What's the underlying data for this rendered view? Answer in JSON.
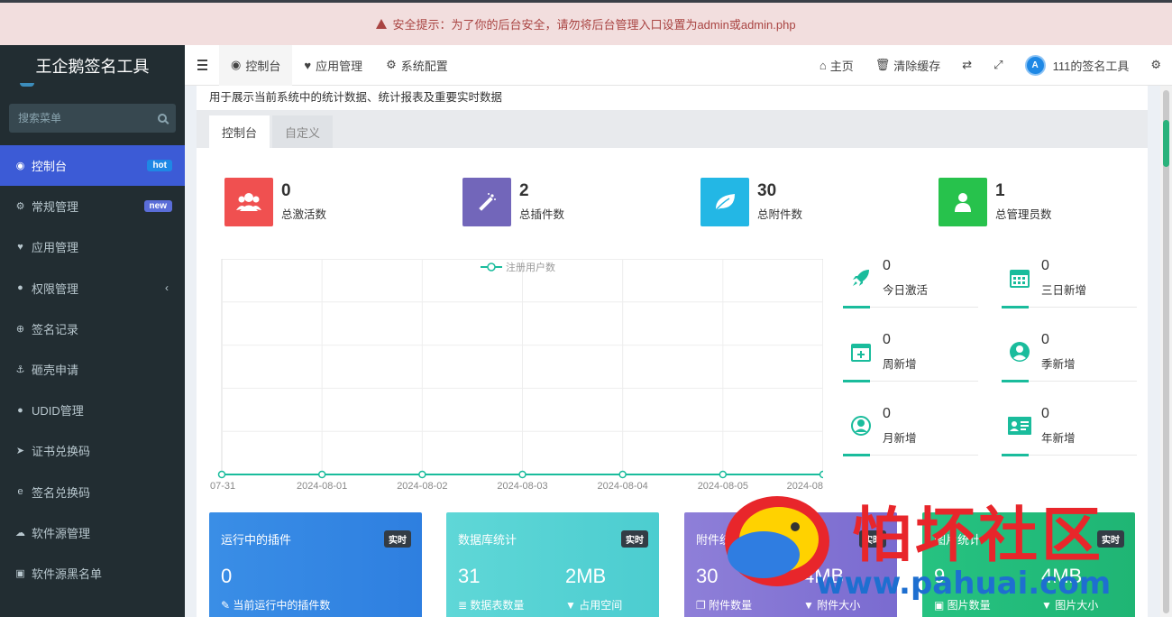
{
  "alert": {
    "text": "安全提示：为了你的后台安全，请勿将后台管理入口设置为admin或admin.php"
  },
  "sidebar": {
    "brand": "王企鹅签名工具",
    "search_placeholder": "搜索菜单",
    "items": [
      {
        "label": "控制台",
        "icon": "dashboard-icon",
        "badge": "hot"
      },
      {
        "label": "常规管理",
        "icon": "cogs-icon",
        "badge": "new"
      },
      {
        "label": "应用管理",
        "icon": "heart-icon"
      },
      {
        "label": "权限管理",
        "icon": "users-icon"
      },
      {
        "label": "签名记录",
        "icon": "download-icon"
      },
      {
        "label": "砸壳申请",
        "icon": "anchor-icon"
      },
      {
        "label": "UDID管理",
        "icon": "apple-icon"
      },
      {
        "label": "证书兑换码",
        "icon": "paper-plane-icon"
      },
      {
        "label": "签名兑换码",
        "icon": "edge-icon"
      },
      {
        "label": "软件源管理",
        "icon": "cloud-icon"
      },
      {
        "label": "软件源黑名单",
        "icon": "box-icon"
      }
    ]
  },
  "topnav": {
    "tabs": [
      "控制台",
      "应用管理",
      "系统配置"
    ],
    "home": "主页",
    "clear_cache": "清除缓存",
    "user": "111的签名工具"
  },
  "page": {
    "description": "用于展示当前系统中的统计数据、统计报表及重要实时数据",
    "tabs": [
      "控制台",
      "自定义"
    ]
  },
  "stats": [
    {
      "value": "0",
      "label": "总激活数",
      "color": "#f05050",
      "icon": "users-icon"
    },
    {
      "value": "2",
      "label": "总插件数",
      "color": "#7266ba",
      "icon": "magic-icon"
    },
    {
      "value": "30",
      "label": "总附件数",
      "color": "#23b7e5",
      "icon": "leaf-icon"
    },
    {
      "value": "1",
      "label": "总管理员数",
      "color": "#27c24c",
      "icon": "user-icon"
    }
  ],
  "mini_stats": [
    {
      "value": "0",
      "label": "今日激活",
      "icon": "rocket-icon"
    },
    {
      "value": "0",
      "label": "三日新增",
      "icon": "calendar-icon"
    },
    {
      "value": "0",
      "label": "周新增",
      "icon": "calendar-plus-icon"
    },
    {
      "value": "0",
      "label": "季新增",
      "icon": "user-circle-icon"
    },
    {
      "value": "0",
      "label": "月新增",
      "icon": "user-circle-o-icon"
    },
    {
      "value": "0",
      "label": "年新增",
      "icon": "id-card-icon"
    }
  ],
  "chart_data": {
    "type": "line",
    "title": "",
    "series": [
      {
        "name": "注册用户数",
        "values": [
          0,
          0,
          0,
          0,
          0,
          0,
          0
        ]
      }
    ],
    "categories": [
      "07-31",
      "2024-08-01",
      "2024-08-02",
      "2024-08-03",
      "2024-08-04",
      "2024-08-05",
      "2024-08"
    ],
    "legend": "top-center",
    "grid": true,
    "color": "#1abc9c"
  },
  "cards": [
    {
      "title": "运行中的插件",
      "tag": "实时",
      "v1": "0",
      "s1": "当前运行中的插件数",
      "v2": "",
      "s2": "",
      "color1": "#3a8ee6",
      "color2": "#2e7fe0"
    },
    {
      "title": "数据库统计",
      "tag": "实时",
      "v1": "31",
      "s1": "数据表数量",
      "v2": "2MB",
      "s2": "占用空间",
      "color1": "#5fd7d7",
      "color2": "#4ccdd0"
    },
    {
      "title": "附件统计",
      "tag": "实时",
      "v1": "30",
      "s1": "附件数量",
      "v2": "4MB",
      "s2": "附件大小",
      "color1": "#8e7fd8",
      "color2": "#7a6bd0"
    },
    {
      "title": "图片统计",
      "tag": "实时",
      "v1": "9",
      "s1": "图片数量",
      "v2": "4MB",
      "s2": "图片大小",
      "color1": "#26c281",
      "color2": "#1fb574"
    }
  ],
  "watermark": {
    "text": "怕坏社区",
    "url": "www.pahuai.com"
  }
}
